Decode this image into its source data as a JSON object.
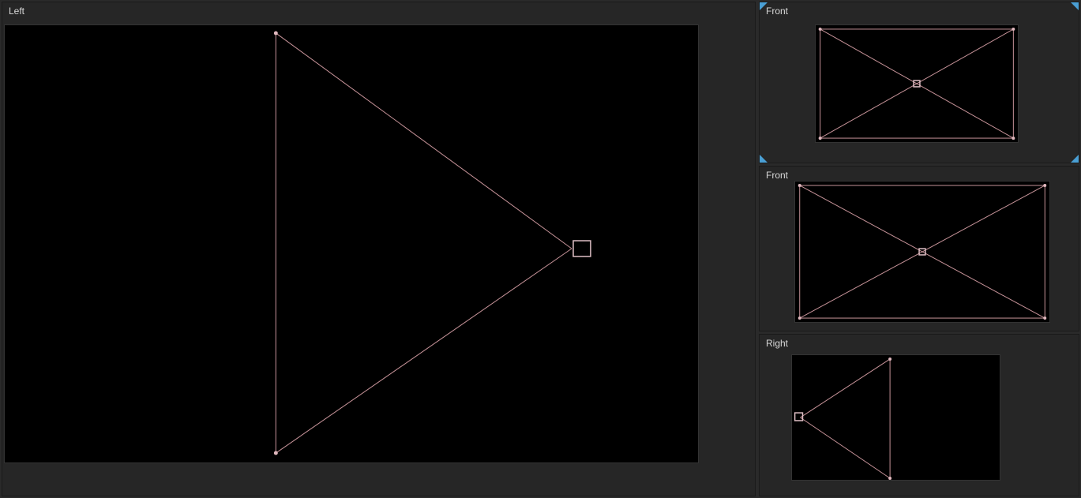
{
  "viewports": {
    "main": {
      "label": "Left"
    },
    "right1": {
      "label": "Front"
    },
    "right2": {
      "label": "Front"
    },
    "right3": {
      "label": "Right"
    }
  },
  "colors": {
    "wireframe": "#c8949a",
    "vertex": "#e0b8be",
    "marker": "#4a9fd4",
    "background": "#262626",
    "viewport_bg": "#000000"
  },
  "geometry": {
    "camera_frustum": {
      "type": "pyramid_frustum"
    }
  }
}
